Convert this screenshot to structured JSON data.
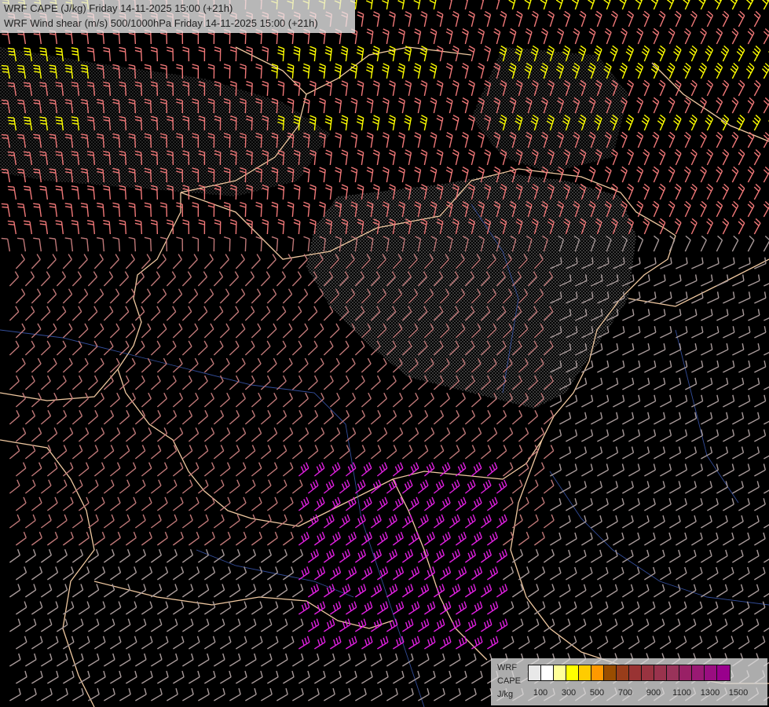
{
  "header": {
    "title_line_1": "WRF CAPE (J/kg) Friday 14-11-2025 15:00 (+21h)",
    "title_line_2": "WRF Wind shear (m/s) 500/1000hPa Friday 14-11-2025 15:00 (+21h)"
  },
  "legend": {
    "label_1": "WRF",
    "label_2": "CAPE",
    "label_3": "J/kg",
    "colors": [
      "#e8e8e8",
      "#ffffff",
      "#ffff99",
      "#ffff00",
      "#ffcc00",
      "#ff9900",
      "#994d00",
      "#993d1a",
      "#993333",
      "#993340",
      "#99334d",
      "#99335a",
      "#992066",
      "#991973",
      "#990d80",
      "#99008c"
    ],
    "tick_labels": [
      "100",
      "300",
      "500",
      "700",
      "900",
      "1100",
      "1300",
      "1500"
    ]
  },
  "map": {
    "barb_colors": {
      "weak": "#a89a9a",
      "moderate": "#c07878",
      "strong": "#f07878",
      "very_strong": "#e020e0",
      "extreme": "#ffff00"
    },
    "border_color": "#f0c8a0",
    "river_color": "#4060c0",
    "cape_pattern_color": "#cccccc"
  }
}
